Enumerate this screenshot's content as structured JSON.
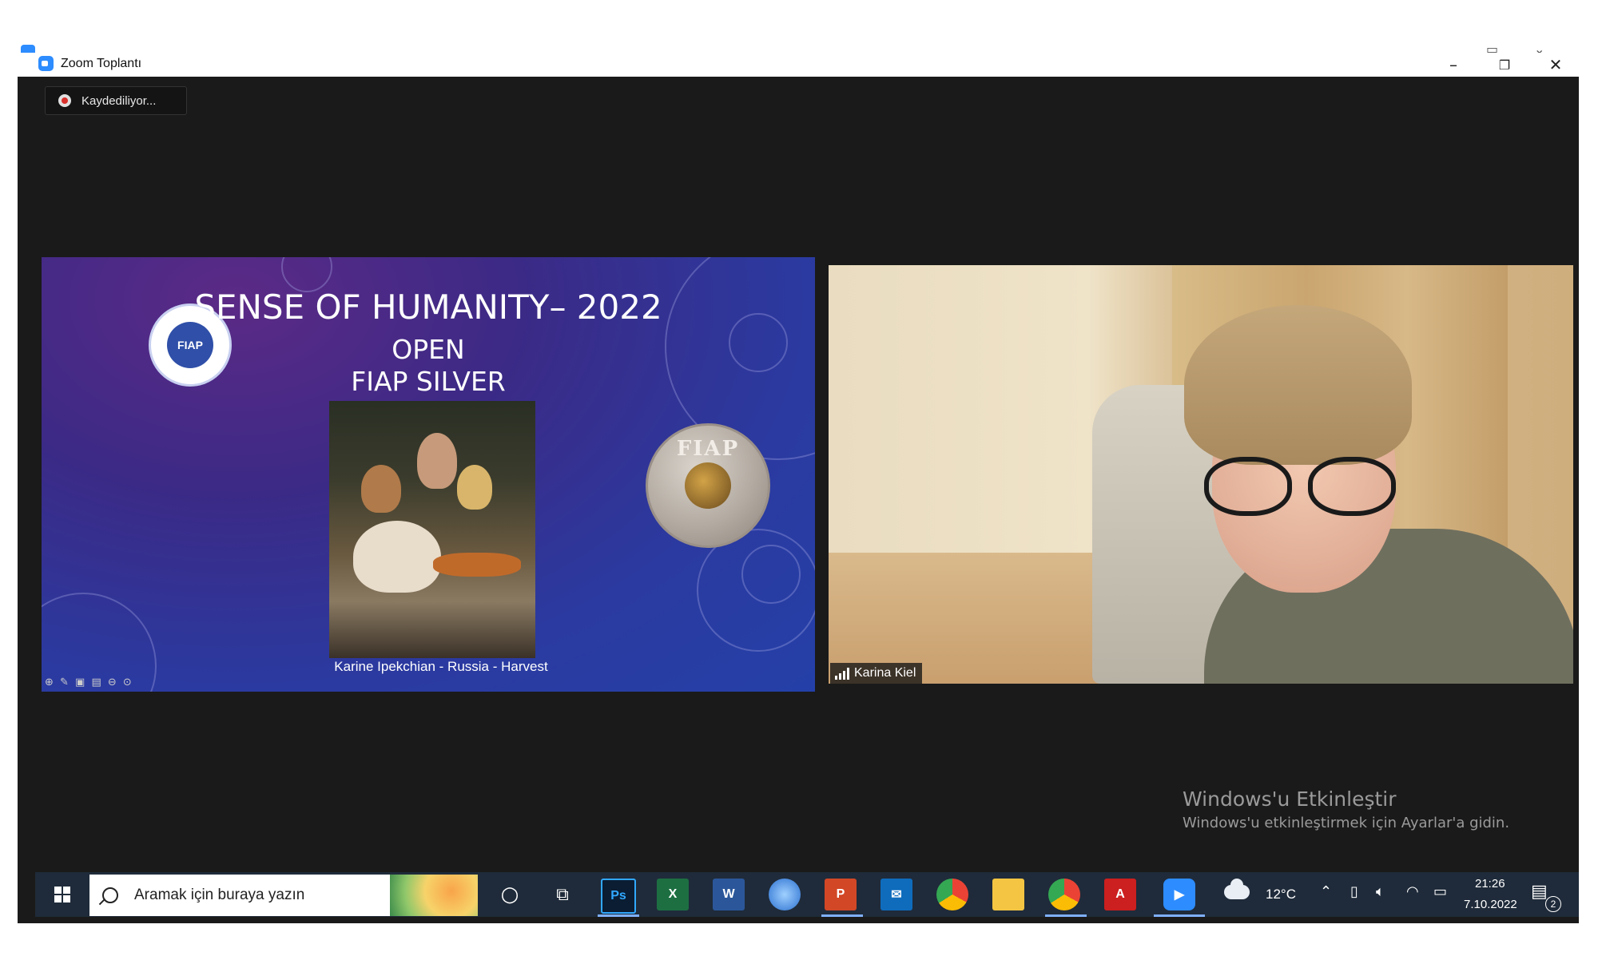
{
  "window": {
    "title": "Zoom Toplantı",
    "minimize": "–",
    "restore": "❐",
    "close": "✕"
  },
  "recording": {
    "label": "Kaydediliyor..."
  },
  "slide": {
    "title_line1": "SENSE OF HUMANITY– 2022",
    "title_line2": "OPEN",
    "title_line3": "FIAP SILVER",
    "logo_text": "FIAP",
    "medal_text": "FIAP",
    "caption": "Karine Ipekchian - Russia - Harvest"
  },
  "participant": {
    "name": "Karina Kiel"
  },
  "watermark": {
    "title": "Windows'u Etkinleştir",
    "subtitle": "Windows'u etkinleştirmek için Ayarlar'a gidin."
  },
  "taskbar": {
    "search_placeholder": "Aramak için buraya yazın",
    "apps": [
      {
        "name": "photoshop",
        "label": "Ps",
        "color": "#0a1d33",
        "fg": "#31a8ff"
      },
      {
        "name": "excel",
        "label": "X",
        "color": "#1d6f42",
        "fg": "#ffffff"
      },
      {
        "name": "word",
        "label": "W",
        "color": "#2b579a",
        "fg": "#ffffff"
      },
      {
        "name": "powerpoint",
        "label": "P",
        "color": "#d24726",
        "fg": "#ffffff"
      },
      {
        "name": "mail",
        "label": "✉",
        "color": "#0f6cbd",
        "fg": "#ffffff"
      },
      {
        "name": "adobe-reader",
        "label": "A",
        "color": "#cc1f1f",
        "fg": "#ffffff"
      },
      {
        "name": "zoom",
        "label": "▶",
        "color": "#2d8cff",
        "fg": "#ffffff"
      }
    ],
    "weather": "12°C",
    "time": "21:26",
    "date": "7.10.2022",
    "notification_count": "2"
  }
}
